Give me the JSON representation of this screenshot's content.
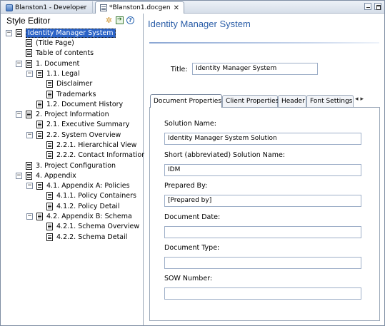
{
  "editor_tabs": [
    {
      "label": "Blanston1 - Developer",
      "active": false
    },
    {
      "label": "*Blanston1.docgen",
      "active": true
    }
  ],
  "left_panel": {
    "title": "Style Editor",
    "toolbar_icons": [
      "wand-icon",
      "export-icon",
      "help-icon"
    ]
  },
  "tree": [
    {
      "label": "Identity Manager System",
      "toggle": "minus",
      "selected": true
    },
    {
      "label": "(Title Page)"
    },
    {
      "label": "Table of contents"
    },
    {
      "label": "1. Document",
      "toggle": "minus"
    },
    {
      "label": "1.1. Legal",
      "toggle": "minus"
    },
    {
      "label": "Disclaimer"
    },
    {
      "label": "Trademarks"
    },
    {
      "label": "1.2. Document History"
    },
    {
      "label": "2. Project  Information",
      "toggle": "minus"
    },
    {
      "label": "2.1. Executive Summary"
    },
    {
      "label": "2.2. System Overview",
      "toggle": "minus"
    },
    {
      "label": "2.2.1. Hierarchical View"
    },
    {
      "label": "2.2.2. Contact Information"
    },
    {
      "label": "3. Project Configuration"
    },
    {
      "label": "4. Appendix",
      "toggle": "minus"
    },
    {
      "label": "4.1. Appendix A: Policies",
      "toggle": "minus"
    },
    {
      "label": "4.1.1. Policy Containers"
    },
    {
      "label": "4.1.2. Policy Detail"
    },
    {
      "label": "4.2. Appendix B: Schema",
      "toggle": "minus"
    },
    {
      "label": "4.2.1. Schema Overview"
    },
    {
      "label": "4.2.2. Schema Detail"
    }
  ],
  "right_panel": {
    "heading": "Identity Manager System",
    "title_label": "Title:",
    "title_value": "Identity Manager System",
    "tabs": [
      "Document Properties",
      "Client Properties",
      "Header",
      "Font Settings"
    ],
    "active_tab": "Document Properties",
    "fields": [
      {
        "label": "Solution Name:",
        "value": "Identity Manager System Solution"
      },
      {
        "label": "Short (abbreviated) Solution Name:",
        "value": "IDM"
      },
      {
        "label": "Prepared By:",
        "value": "[Prepared by]"
      },
      {
        "label": "Document Date:",
        "value": ""
      },
      {
        "label": "Document Type:",
        "value": ""
      },
      {
        "label": "SOW Number:",
        "value": ""
      }
    ]
  }
}
